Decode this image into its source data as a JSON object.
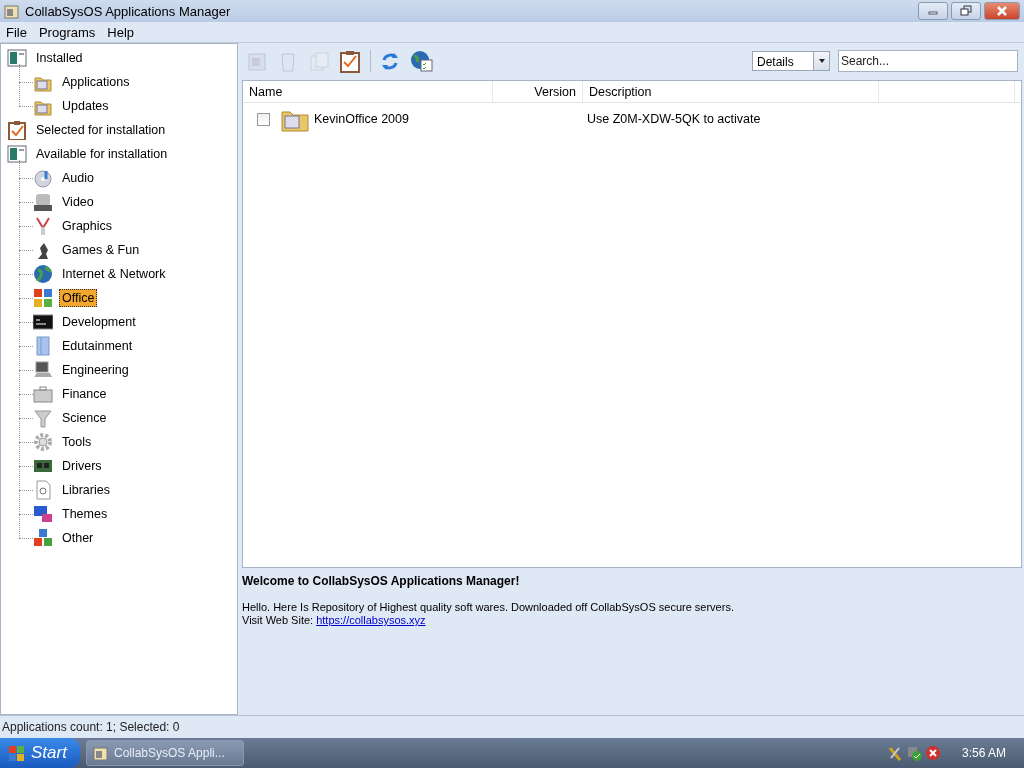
{
  "window": {
    "title": "CollabSysOS Applications Manager"
  },
  "menu": [
    "File",
    "Programs",
    "Help"
  ],
  "tree": [
    {
      "label": "Installed",
      "selected": false,
      "children": [
        {
          "label": "Applications",
          "selected": false
        },
        {
          "label": "Updates",
          "selected": false
        }
      ]
    },
    {
      "label": "Selected for installation",
      "selected": false
    },
    {
      "label": "Available for installation",
      "selected": false,
      "children": [
        {
          "label": "Audio",
          "selected": false
        },
        {
          "label": "Video",
          "selected": false
        },
        {
          "label": "Graphics",
          "selected": false
        },
        {
          "label": "Games & Fun",
          "selected": false
        },
        {
          "label": "Internet & Network",
          "selected": false
        },
        {
          "label": "Office",
          "selected": true
        },
        {
          "label": "Development",
          "selected": false
        },
        {
          "label": "Edutainment",
          "selected": false
        },
        {
          "label": "Engineering",
          "selected": false
        },
        {
          "label": "Finance",
          "selected": false
        },
        {
          "label": "Science",
          "selected": false
        },
        {
          "label": "Tools",
          "selected": false
        },
        {
          "label": "Drivers",
          "selected": false
        },
        {
          "label": "Libraries",
          "selected": false
        },
        {
          "label": "Themes",
          "selected": false
        },
        {
          "label": "Other",
          "selected": false
        }
      ]
    }
  ],
  "toolbar": [
    {
      "disabled": true
    },
    {
      "disabled": true
    },
    {
      "disabled": true
    },
    {
      "disabled": false
    },
    {
      "disabled": false
    },
    {
      "disabled": false
    }
  ],
  "view_select": {
    "value": "Details"
  },
  "search": {
    "placeholder": "Search..."
  },
  "table": {
    "columns": [
      "Name",
      "Version",
      "Description"
    ],
    "rows": [
      {
        "checked": false,
        "name": "KevinOffice 2009",
        "description": "Use Z0M-XDW-5QK to activate"
      }
    ]
  },
  "info": {
    "heading": "Welcome to CollabSysOS Applications Manager!",
    "text": "Hello. Here Is Repository of Highest quality soft wares. Downloaded off CollabSysOS secure servers.",
    "link_label": "Visit Web Site:",
    "link": "https://collabsysos.xyz"
  },
  "status_bar": "Applications count: 1; Selected: 0",
  "taskbar": {
    "start": "Start",
    "tasks": [
      "CollabSysOS Appli..."
    ],
    "clock": "3:56 AM"
  }
}
